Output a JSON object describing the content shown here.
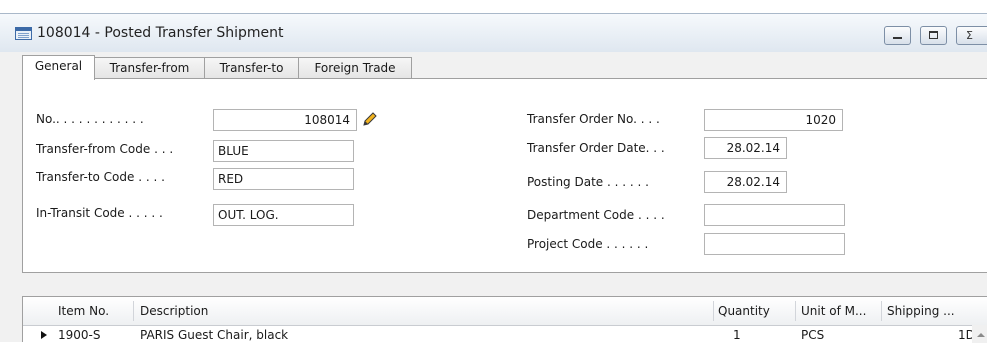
{
  "window": {
    "title": "108014 - Posted Transfer Shipment",
    "controls": {
      "minimize": "",
      "maximize": "",
      "close": "Σ"
    }
  },
  "tabs": [
    {
      "label": "General",
      "active": true
    },
    {
      "label": "Transfer-from",
      "active": false
    },
    {
      "label": "Transfer-to",
      "active": false
    },
    {
      "label": "Foreign Trade",
      "active": false
    }
  ],
  "general": {
    "left": [
      {
        "label": "No.. . . . . . . . . . . .",
        "value": "108014"
      },
      {
        "label": "Transfer-from Code . . .",
        "value": "BLUE"
      },
      {
        "label": "Transfer-to Code . . . .",
        "value": "RED"
      },
      {
        "label": "In-Transit Code . . . . .",
        "value": "OUT. LOG."
      }
    ],
    "right": [
      {
        "label": "Transfer Order No. . . .",
        "value": "1020"
      },
      {
        "label": "Transfer Order Date. . .",
        "value": "28.02.14"
      },
      {
        "label": "Posting Date . . . . . .",
        "value": "28.02.14"
      },
      {
        "label": "Department Code . . . .",
        "value": ""
      },
      {
        "label": "Project Code . . . . . .",
        "value": ""
      }
    ]
  },
  "lines": {
    "columns": [
      "Item No.",
      "Description",
      "Quantity",
      "Unit of M...",
      "Shipping ..."
    ],
    "rows": [
      {
        "item_no": "1900-S",
        "description": "PARIS Guest Chair, black",
        "quantity": "1",
        "unit": "PCS",
        "shipping": "1D"
      }
    ]
  },
  "icons": {
    "title": "window-form-icon",
    "edit": "pencil-icon",
    "row": "row-selector-icon"
  },
  "colors": {
    "title_bar": "#dfe7f0",
    "panel_border": "#a0a0a0",
    "pencil": "#e0a000"
  }
}
